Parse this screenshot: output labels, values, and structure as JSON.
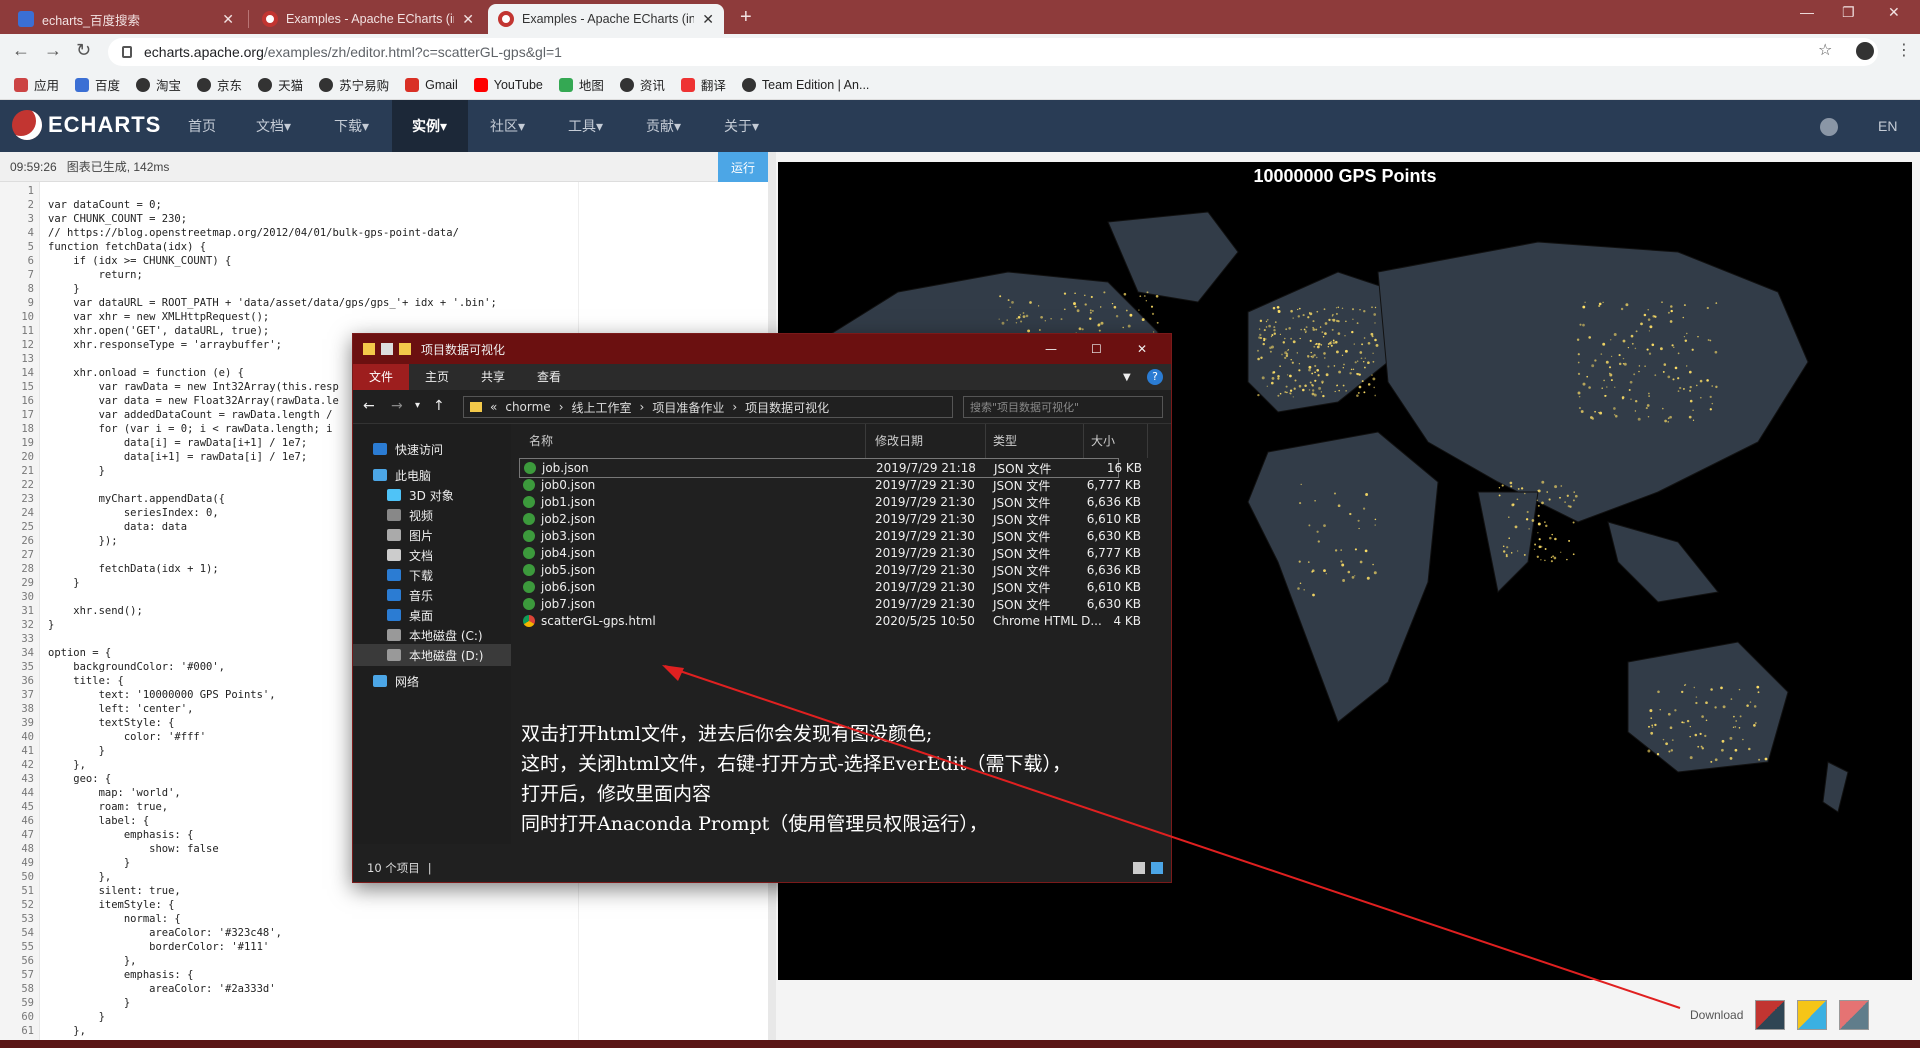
{
  "browser": {
    "tabs": [
      {
        "label": "echarts_百度搜索",
        "active": false
      },
      {
        "label": "Examples - Apache ECharts (in",
        "active": false
      },
      {
        "label": "Examples - Apache ECharts (in",
        "active": true
      }
    ],
    "url_host": "echarts.apache.org",
    "url_path": "/examples/zh/editor.html?c=scatterGL-gps&gl=1",
    "bookmarks": [
      "应用",
      "百度",
      "淘宝",
      "京东",
      "天猫",
      "苏宁易购",
      "Gmail",
      "YouTube",
      "地图",
      "资讯",
      "翻译",
      "Team Edition | An..."
    ]
  },
  "site": {
    "logo": "ECHARTS",
    "nav": [
      "首页",
      "文档▾",
      "下载▾",
      "实例▾",
      "社区▾",
      "工具▾",
      "贡献▾",
      "关于▾"
    ],
    "active_nav": "实例▾",
    "lang": "EN"
  },
  "editor": {
    "status_time": "09:59:26",
    "status_text": "图表已生成, 142ms",
    "run_label": "运行",
    "code": "\nvar dataCount = 0;\nvar CHUNK_COUNT = 230;\n// https://blog.openstreetmap.org/2012/04/01/bulk-gps-point-data/\nfunction fetchData(idx) {\n    if (idx >= CHUNK_COUNT) {\n        return;\n    }\n    var dataURL = ROOT_PATH + 'data/asset/data/gps/gps_'+ idx + '.bin';\n    var xhr = new XMLHttpRequest();\n    xhr.open('GET', dataURL, true);\n    xhr.responseType = 'arraybuffer';\n\n    xhr.onload = function (e) {\n        var rawData = new Int32Array(this.resp\n        var data = new Float32Array(rawData.le\n        var addedDataCount = rawData.length /\n        for (var i = 0; i < rawData.length; i\n            data[i] = rawData[i+1] / 1e7;\n            data[i+1] = rawData[i] / 1e7;\n        }\n\n        myChart.appendData({\n            seriesIndex: 0,\n            data: data\n        });\n\n        fetchData(idx + 1);\n    }\n\n    xhr.send();\n}\n\noption = {\n    backgroundColor: '#000',\n    title: {\n        text: '10000000 GPS Points',\n        left: 'center',\n        textStyle: {\n            color: '#fff'\n        }\n    },\n    geo: {\n        map: 'world',\n        roam: true,\n        label: {\n            emphasis: {\n                show: false\n            }\n        },\n        silent: true,\n        itemStyle: {\n            normal: {\n                areaColor: '#323c48',\n                borderColor: '#111'\n            },\n            emphasis: {\n                areaColor: '#2a333d'\n            }\n        }\n    },"
  },
  "chart": {
    "title": "10000000 GPS Points",
    "download_label": "Download",
    "land_color": "#323c48",
    "point_color": "#ffe066"
  },
  "explorer": {
    "title": "项目数据可视化",
    "ribbon": [
      "文件",
      "主页",
      "共享",
      "查看"
    ],
    "breadcrumb": [
      "chorme",
      "线上工作室",
      "项目准备作业",
      "项目数据可视化"
    ],
    "search_placeholder": "搜索\"项目数据可视化\"",
    "nav": [
      "快速访问",
      "此电脑",
      "3D 对象",
      "视频",
      "图片",
      "文档",
      "下载",
      "音乐",
      "桌面",
      "本地磁盘 (C:)",
      "本地磁盘 (D:)",
      "网络"
    ],
    "columns": [
      "名称",
      "修改日期",
      "类型",
      "大小"
    ],
    "files": [
      {
        "name": "job.json",
        "date": "2019/7/29 21:18",
        "type": "JSON 文件",
        "size": "16 KB"
      },
      {
        "name": "job0.json",
        "date": "2019/7/29 21:30",
        "type": "JSON 文件",
        "size": "6,777 KB"
      },
      {
        "name": "job1.json",
        "date": "2019/7/29 21:30",
        "type": "JSON 文件",
        "size": "6,636 KB"
      },
      {
        "name": "job2.json",
        "date": "2019/7/29 21:30",
        "type": "JSON 文件",
        "size": "6,610 KB"
      },
      {
        "name": "job3.json",
        "date": "2019/7/29 21:30",
        "type": "JSON 文件",
        "size": "6,630 KB"
      },
      {
        "name": "job4.json",
        "date": "2019/7/29 21:30",
        "type": "JSON 文件",
        "size": "6,777 KB"
      },
      {
        "name": "job5.json",
        "date": "2019/7/29 21:30",
        "type": "JSON 文件",
        "size": "6,636 KB"
      },
      {
        "name": "job6.json",
        "date": "2019/7/29 21:30",
        "type": "JSON 文件",
        "size": "6,610 KB"
      },
      {
        "name": "job7.json",
        "date": "2019/7/29 21:30",
        "type": "JSON 文件",
        "size": "6,630 KB"
      },
      {
        "name": "scatterGL-gps.html",
        "date": "2020/5/25 10:50",
        "type": "Chrome HTML D...",
        "size": "4 KB"
      }
    ],
    "overlay_lines": [
      "双击打开html文件，进去后你会发现有图没颜色;",
      "这时，关闭html文件，右键-打开方式-选择EverEdit（需下载），",
      "打开后，修改里面内容",
      "同时打开Anaconda Prompt（使用管理员权限运行），"
    ],
    "status": "10 个项目"
  }
}
